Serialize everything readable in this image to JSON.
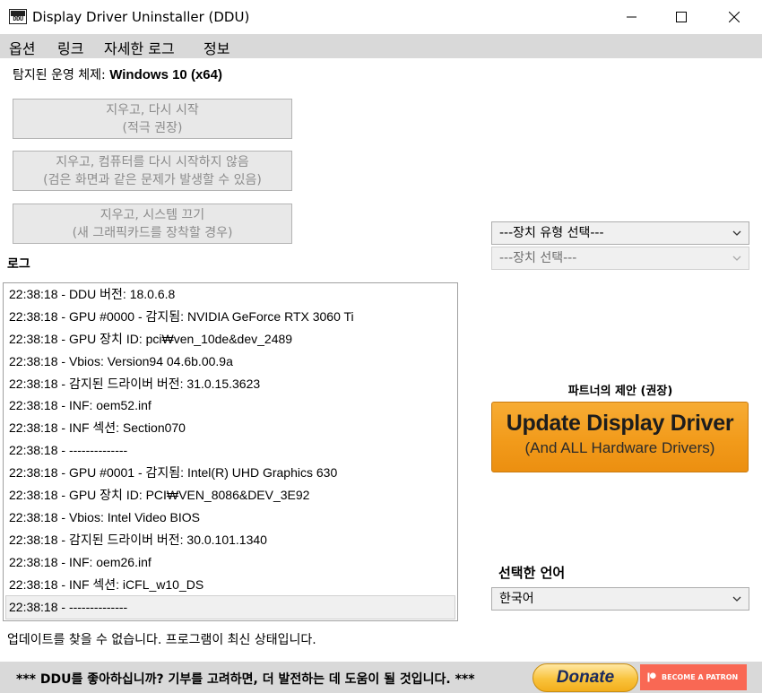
{
  "window": {
    "title": "Display Driver Uninstaller (DDU)",
    "icon_text": "DDU"
  },
  "menu": {
    "items": [
      {
        "label": "옵션"
      },
      {
        "label": "링크"
      },
      {
        "label": "자세한 로그"
      },
      {
        "label": "정보"
      }
    ]
  },
  "os": {
    "label": "탐지된 운영 체제:",
    "value": "Windows 10 (x64)"
  },
  "actions": {
    "clean_restart": {
      "line1": "지우고, 다시 시작",
      "line2": "(적극 권장)"
    },
    "clean_no_restart": {
      "line1": "지우고, 컴퓨터를 다시 시작하지 않음",
      "line2": "(검은 화면과 같은 문제가 발생할 수 있음)"
    },
    "clean_shutdown": {
      "line1": "지우고, 시스템 끄기",
      "line2": "(새 그래픽카드를 장착할 경우)"
    }
  },
  "log": {
    "label": "로그",
    "lines": [
      "22:38:18 - DDU 버전: 18.0.6.8",
      "22:38:18 - GPU #0000 - 감지됨: NVIDIA GeForce RTX 3060 Ti",
      "22:38:18 - GPU 장치 ID: pci₩ven_10de&dev_2489",
      "22:38:18 - Vbios: Version94 04.6b.00.9a",
      "22:38:18 - 감지된 드라이버 버전: 31.0.15.3623",
      "22:38:18 - INF: oem52.inf",
      "22:38:18 - INF 섹션: Section070",
      "22:38:18 - --------------",
      "22:38:18 - GPU #0001 - 감지됨: Intel(R) UHD Graphics 630",
      "22:38:18 - GPU 장치 ID: PCI₩VEN_8086&DEV_3E92",
      "22:38:18 - Vbios: Intel Video BIOS",
      "22:38:18 - 감지된 드라이버 버전: 30.0.101.1340",
      "22:38:18 - INF: oem26.inf",
      "22:38:18 - INF 섹션: iCFL_w10_DS",
      "22:38:18 - --------------"
    ]
  },
  "status": "업데이트를 찾을 수 없습니다. 프로그램이 최신 상태입니다.",
  "device_type_select": {
    "value": "---장치 유형 선택---"
  },
  "device_select": {
    "value": "---장치 선택---"
  },
  "partner": {
    "label": "파트너의 제안 (권장)",
    "button_main": "Update Display Driver",
    "button_sub": "(And ALL Hardware Drivers)"
  },
  "language": {
    "label": "선택한 언어",
    "value": "한국어"
  },
  "footer": {
    "text": "*** DDU를 좋아하십니까? 기부를 고려하면, 더 발전하는 데 도움이 될 것입니다. ***",
    "donate_label": "Donate",
    "patreon_label": "BECOME A PATRON"
  },
  "colors": {
    "menubar": "#d9d9d9",
    "update_orange": "#f29b1b",
    "patreon": "#f96854",
    "donate_gold": "#f9c33c"
  }
}
